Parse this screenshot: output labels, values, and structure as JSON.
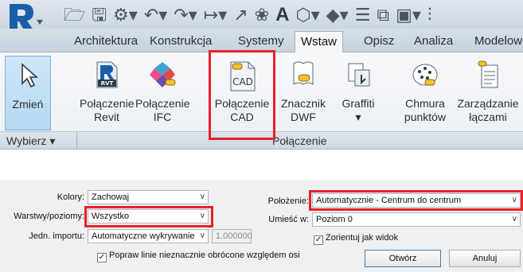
{
  "colors": {
    "highlight": "#e8202a",
    "ribbon": "#dfe6ee",
    "selected": "#b6d8f2"
  },
  "quick_access": {
    "text_tool": "A"
  },
  "tabs": [
    "Architektura",
    "Konstrukcja",
    "Systemy",
    "Wstaw",
    "Opisz",
    "Analiza",
    "Modelow"
  ],
  "active_tab": "Wstaw",
  "ribbon": {
    "modify": {
      "label": "Zmień",
      "icon": "cursor-arrow-icon"
    },
    "buttons": [
      {
        "label1": "Połączenie",
        "label2": "Revit",
        "icon": "revit-link-icon",
        "badge": "RVT"
      },
      {
        "label1": "Połączenie",
        "label2": "IFC",
        "icon": "ifc-link-icon"
      },
      {
        "label1": "Połączenie",
        "label2": "CAD",
        "icon": "cad-link-icon",
        "badge": "CAD"
      },
      {
        "label1": "Znacznik",
        "label2": "DWF",
        "icon": "dwf-markup-icon"
      },
      {
        "label1": "Graffiti",
        "label2": "",
        "icon": "graffiti-icon"
      },
      {
        "label1": "Chmura",
        "label2": "punktów",
        "icon": "point-cloud-icon"
      },
      {
        "label1": "Zarządzanie",
        "label2": "łączami",
        "icon": "manage-links-icon"
      }
    ],
    "select_panel": "Wybierz",
    "link_panel": "Połączenie"
  },
  "options": {
    "colors_label": "Kolory:",
    "colors_value": "Zachowaj",
    "layers_label": "Warstwy/poziomy:",
    "layers_value": "Wszystko",
    "import_units_label": "Jedn. importu:",
    "import_units_value": "Automatyczne wykrywanie",
    "scale_value": "1.000000",
    "fix_lines_label": "Popraw linie nieznacznie obrócone względem osi",
    "fix_lines_checked": true,
    "position_label": "Położenie:",
    "position_value": "Automatycznie - Centrum do centrum",
    "place_at_label": "Umieść w:",
    "place_at_value": "Poziom 0",
    "orient_label": "Zorientuj jak widok",
    "orient_checked": true,
    "open_button": "Otwórz",
    "cancel_button": "Anuluj"
  }
}
